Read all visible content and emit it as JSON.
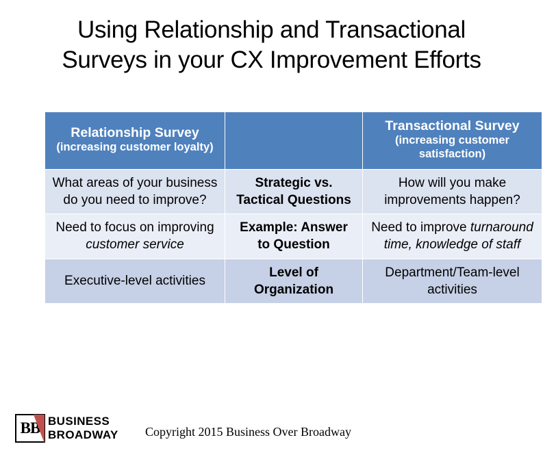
{
  "slide": {
    "title_line1": "Using Relationship and Transactional",
    "title_line2": "Surveys in your CX Improvement Efforts"
  },
  "table": {
    "header": {
      "left_main": "Relationship Survey",
      "left_sub": "(increasing customer loyalty)",
      "middle": "",
      "right_main": "Transactional Survey",
      "right_sub": "(increasing customer satisfaction)"
    },
    "rows": [
      {
        "left": "What areas of your business do you need to improve?",
        "middle": "Strategic vs. Tactical Questions",
        "right": "How will you make improvements happen?"
      },
      {
        "left_plain": "Need to focus on improving ",
        "left_italic": "customer service",
        "middle": "Example: Answer to Question",
        "right_plain": "Need to improve ",
        "right_italic": "turnaround time, knowledge of staff"
      },
      {
        "left": "Executive-level activities",
        "middle": "Level of Organization",
        "right": "Department/Team-level activities"
      }
    ]
  },
  "footer": {
    "logo_mark_text": "BB",
    "logo_line1": "BUSINESS",
    "logo_line2": "BROADWAY",
    "copyright": "Copyright 2015 Business Over Broadway"
  },
  "colors": {
    "header_blue": "#4f81bd",
    "band_light": "#eaeef7",
    "band_mid": "#dbe2f0",
    "band_dark": "#c6d0e6",
    "logo_red": "#c0504d"
  }
}
